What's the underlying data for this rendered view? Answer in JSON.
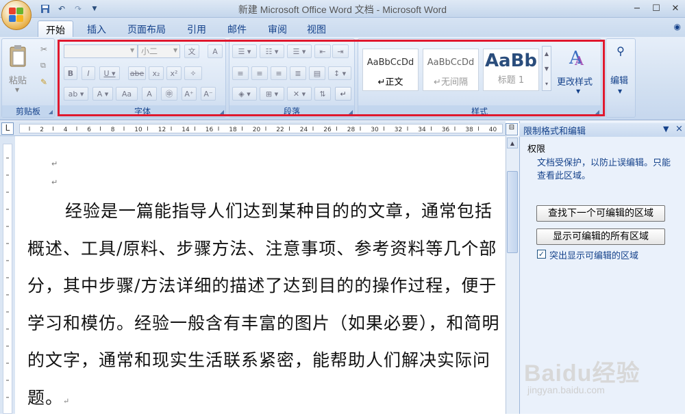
{
  "window": {
    "title": "新建 Microsoft Office Word 文档 - Microsoft Word"
  },
  "qat": {
    "save_icon": "save-icon",
    "undo_icon": "undo-icon",
    "redo_icon": "redo-icon"
  },
  "tabs": [
    "开始",
    "插入",
    "页面布局",
    "引用",
    "邮件",
    "审阅",
    "视图"
  ],
  "ribbon": {
    "clipboard": {
      "paste_label": "粘贴",
      "group_label": "剪贴板"
    },
    "font": {
      "font_name": "",
      "font_size": "小二",
      "group_label": "字体",
      "change_case": "Aa"
    },
    "paragraph": {
      "group_label": "段落"
    },
    "styles": {
      "group_label": "样式",
      "cards": [
        {
          "sample": "AaBbCcDd",
          "name": "↵正文"
        },
        {
          "sample": "AaBbCcDd",
          "name": "↵无间隔"
        },
        {
          "sample": "AaBb",
          "name": "标题 1"
        }
      ],
      "change_styles": "更改样式"
    },
    "editing": {
      "label": "编辑"
    }
  },
  "ruler": {
    "ticks": [
      "2",
      "4",
      "6",
      "8",
      "10",
      "12",
      "14",
      "16",
      "18",
      "20",
      "22",
      "24",
      "26",
      "28",
      "30",
      "32",
      "34",
      "36",
      "38",
      "40"
    ]
  },
  "document": {
    "empty_mark1": "↵",
    "empty_mark2": "↵",
    "paragraph": "经验是一篇能指导人们达到某种目的的文章，通常包括概述、工具/原料、步骤方法、注意事项、参考资料等几个部分，其中步骤/方法详细的描述了达到目的的操作过程，便于学习和模仿。经验一般含有丰富的图片（如果必要），和简明的文字，通常和现实生活联系紧密，能帮助人们解决实际问题。",
    "end_mark": "↵"
  },
  "task_pane": {
    "title": "限制格式和编辑",
    "section": "权限",
    "info": "文档受保护，以防止误编辑。只能查看此区域。",
    "find_next_button": "查找下一个可编辑的区域",
    "show_all_button": "显示可编辑的所有区域",
    "highlight_checkbox": "突出显示可编辑的区域",
    "highlight_checked": true
  },
  "watermark": {
    "brand": "Baidu经验",
    "url": "jingyan.baidu.com"
  },
  "colors": {
    "accent": "#15428b",
    "highlight_border": "#e0182e",
    "ribbon_bg": "#d2e0f1"
  }
}
